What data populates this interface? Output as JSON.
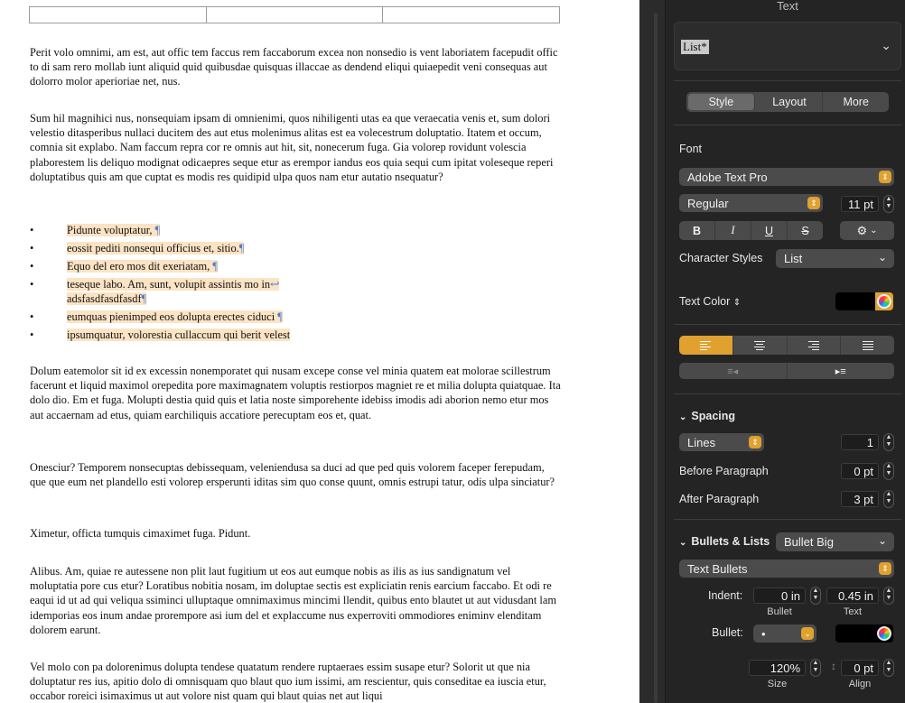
{
  "document": {
    "paragraphs_before": [
      "Perit volo omnimi, am est, aut offic tem faccus rem faccaborum excea non nonsedio is vent laboriatem facepudit offic to di sam rero mollab iunt aliquid quid quibusdae quisquas illaccae as dendend eliqui quiaepedit veni consequas aut dolorro molor aperioriae net, nus.",
      "Sum hil magnihici nus, nonsequiam ipsam di omnienimi, quos nihiligenti utas ea que veraecatia venis et, sum dolori velestio ditasperibus nullaci ducitem des aut etus molenimus alitas est ea volecestrum doluptatio. Itatem et occum, comnia sit explabo. Nam faccum repra cor re omnis aut hit, sit, nonecerum fuga. Gia volorep rovidunt volescia plaborestem lis deliquo modignat odicaepres seque etur as erempor iandus eos quia sequi cum ipitat voleseque reperi doluptatibus quis am que cuptat es modis res quidipid ulpa quos nam etur autatio nsequatur?"
    ],
    "bullet_char": "•",
    "bullets": [
      {
        "text": "Pidunte voluptatur, ",
        "mark": "¶"
      },
      {
        "text": "eossit pediti nonsequi officius et, sitio.",
        "mark": "¶"
      },
      {
        "text": " Equo del ero mos dit exeriatam, ",
        "mark": "¶"
      },
      {
        "text": "teseque labo. Am, sunt, volupit assintis mo in",
        "mark": "↩",
        "text2": "adsfasdfasdfasdf",
        "mark2": "¶"
      },
      {
        "text": "eumquas pienimped eos dolupta erectes ciduci ",
        "mark": "¶"
      },
      {
        "text": "ipsumquatur, volorestia cullaccum qui berit velest",
        "mark": ""
      }
    ],
    "paragraphs_after": [
      "Dolum eatemolor sit id ex excessin nonemporatet qui nusam excepe conse vel minia quatem eat molorae scillestrum facerunt et liquid maximol orepedita pore maximagnatem voluptis restiorpos magniet re et milia dolupta quiatquae. Ita dolo dio. Em et fuga. Molupti destia quid quis et latia noste simporehente idebiss imodis adi aborion nemo etur mos aut accaernam ad etus, quiam earchiliquis accatiore perecuptam eos et, quat.",
      "Onesciur? Temporem nonsecuptas debissequam, veleniendusa sa duci ad que ped quis volorem faceper ferepudam, que que eum net plandello esti volorep ersperunti iditas sim quo conse quunt, omnis estrupi tatur, odis ulpa sinciatur?",
      "Ximetur, officta tumquis cimaximet fuga. Pidunt.",
      "Alibus. Am, quiae re autessene non plit laut fugitium ut eos aut eumque nobis as ilis as ius sandignatum vel moluptatia pore cus etur? Loratibus nobitia nosam, im doluptae sectis est expliciatin renis earcium faccabo. Et odi re eaqui id ut ad qui veliqua ssiminci ulluptaque omnimaximus mincimi llendit, quibus ento blautet ut aut vidusdant lam idemporias eos inum andae prorempore asi ium del et explaccume nus experroviti ommodiores eniminv elenditam dolorem earunt.",
      "Vel molo con pa dolorenimus dolupta tendese quatatum rendere ruptaeraes essim susape etur? Solorit ut que nia doluptatur res ius, apitio dolo di omnisquam quo blaut quo ium issimi, am rescientur, quis conseditae ea iuscia etur, occabor roreici isimaximus ut aut volore nist quam qui blaut quias net aut liqui"
    ]
  },
  "inspector": {
    "header": "Text",
    "paragraph_style": "List*",
    "tabs": [
      "Style",
      "Layout",
      "More"
    ],
    "font_section": "Font",
    "font_family": "Adobe Text Pro",
    "font_typeface": "Regular",
    "font_size": "11 pt",
    "format_buttons": [
      "B",
      "I",
      "U",
      "S"
    ],
    "gear_symbol": "⚙",
    "character_styles_label": "Character Styles",
    "character_styles_value": "List",
    "text_color_label": "Text Color",
    "spacing_label": "Spacing",
    "spacing_mode": "Lines",
    "spacing_value": "1",
    "before_paragraph_label": "Before Paragraph",
    "before_paragraph_value": "0 pt",
    "after_paragraph_label": "After Paragraph",
    "after_paragraph_value": "3 pt",
    "bullets_label": "Bullets & Lists",
    "bullets_style": "Bullet Big",
    "bullets_type": "Text Bullets",
    "indent_label": "Indent:",
    "indent_bullet_value": "0 in",
    "indent_text_value": "0.45 in",
    "bullet_caption": "Bullet",
    "text_caption": "Text",
    "bullet_label": "Bullet:",
    "bullet_value": "•",
    "size_value": "120%",
    "align_value": "0 pt",
    "size_caption": "Size",
    "align_caption": "Align",
    "colors": {
      "accent": "#e0a12f",
      "panel": "#242424",
      "control": "#4b4b4b",
      "highlight": "#fbe3c4",
      "invisibles": "#4a7dd6"
    }
  }
}
